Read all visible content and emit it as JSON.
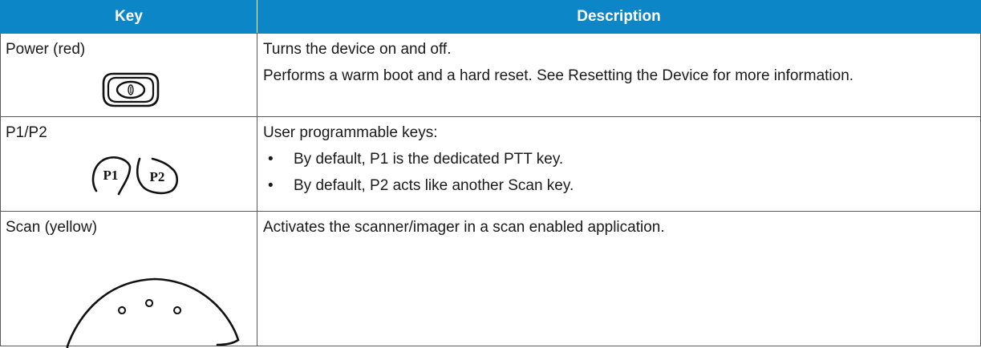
{
  "table": {
    "headers": {
      "key": "Key",
      "description": "Description"
    },
    "rows": [
      {
        "key": "Power (red)",
        "icon": "power-button-icon",
        "desc": [
          "Turns the device on and off.",
          "Performs a warm boot and a hard reset. See Resetting the Device for more information."
        ]
      },
      {
        "key": "P1/P2",
        "icon": "p1-p2-buttons-icon",
        "intro": "User programmable keys:",
        "bullets": [
          "By default, P1 is the dedicated PTT key.",
          "By default, P2 acts like another Scan key."
        ],
        "bullet_char": "•",
        "icon_labels": [
          "P1",
          "P2"
        ]
      },
      {
        "key": "Scan (yellow)",
        "icon": "scan-button-icon",
        "desc": [
          "Activates the scanner/imager in a scan enabled application."
        ]
      }
    ]
  },
  "colors": {
    "header_bg": "#0d86c8",
    "header_text": "#ffffff",
    "border": "#5a5a5a"
  }
}
